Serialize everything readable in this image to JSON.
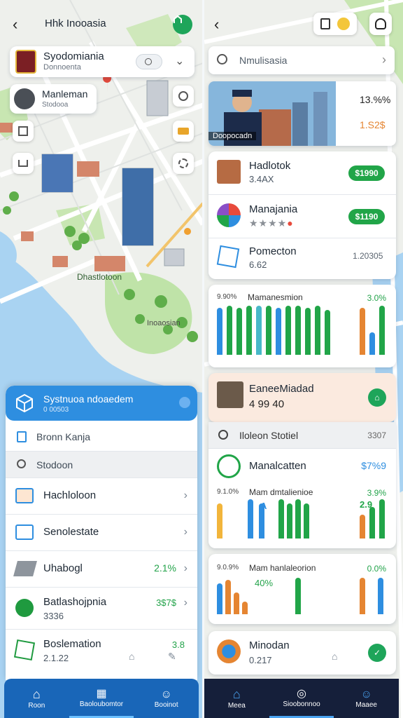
{
  "left": {
    "title": "Hhk Inooasia",
    "profile_card": {
      "name": "Syodomiania",
      "sub": "Donnoenta"
    },
    "member_card": {
      "name": "Manleman",
      "sub": "Stodooa"
    },
    "map_labels": {
      "park": "Dhastlotoon",
      "place": "Inoaosian"
    },
    "sheet": {
      "header_title": "Systnuoa ndoaedem",
      "header_sub": "0 00503",
      "rows": [
        {
          "label": "Bronn Kanja",
          "kind": "input"
        },
        {
          "label": "Stodoon",
          "kind": "search"
        },
        {
          "label": "Hachloloon",
          "kind": "nav"
        },
        {
          "label": "Senolestate",
          "kind": "nav"
        },
        {
          "label": "Uhabogl",
          "value": "2.1%",
          "kind": "value"
        },
        {
          "label": "Batlashojpnia",
          "sub": "3336",
          "value": "3$7$",
          "kind": "value"
        },
        {
          "label": "Boslemation",
          "sub": "2.1.22",
          "value": "3.8",
          "kind": "value"
        }
      ]
    },
    "nav": [
      {
        "label": "Roon",
        "icon": "home-icon"
      },
      {
        "label": "Baoloubomtor",
        "icon": "buildings-icon"
      },
      {
        "label": "Booinot",
        "icon": "user-icon"
      }
    ]
  },
  "right": {
    "search": {
      "placeholder": "Nmulisasia"
    },
    "hero": {
      "caption": "Doopocadn",
      "stat1": "13.%%",
      "stat2": "1.S2$"
    },
    "list": [
      {
        "title": "Hadlotok",
        "sub": "3.4AX",
        "badge": "$1990"
      },
      {
        "title": "Manajania",
        "sub": "",
        "badge": "$1190"
      },
      {
        "title": "Pomecton",
        "sub": "6.62",
        "badge": "1.20305"
      }
    ],
    "chart1": {
      "left_label": "9.90%",
      "title": "Mamanesmion",
      "right_label": "3.0%"
    },
    "feature": {
      "title": "EaneeMiadad",
      "value": "4 99 40"
    },
    "search2": {
      "label": "Iloleon Stotiel",
      "value": "3307"
    },
    "item2": {
      "title": "Manalcatten",
      "badge": "$7%9"
    },
    "chart2": {
      "left_label": "9.1.0%",
      "title": "Mam dmtalienioe",
      "right_label": "3.9%",
      "mark1": "A",
      "mark2": "2.9"
    },
    "chart3": {
      "left_label": "9.0.9%",
      "title": "Mam hanlaleorion",
      "mid_label": "40%",
      "right_label": "0.0%"
    },
    "bottom_card": {
      "title": "Minodan",
      "sub": "0.217"
    },
    "nav": [
      {
        "label": "Meea",
        "icon": "home-icon"
      },
      {
        "label": "Sioobonnoo",
        "icon": "compass-icon"
      },
      {
        "label": "Maaee",
        "icon": "user-icon"
      }
    ],
    "rating_stars": 4
  },
  "colors": {
    "blue": "#2e8ee0",
    "green": "#21a548",
    "orange": "#e58532",
    "nav_left": "#1966b8",
    "nav_right": "#151f3a"
  }
}
